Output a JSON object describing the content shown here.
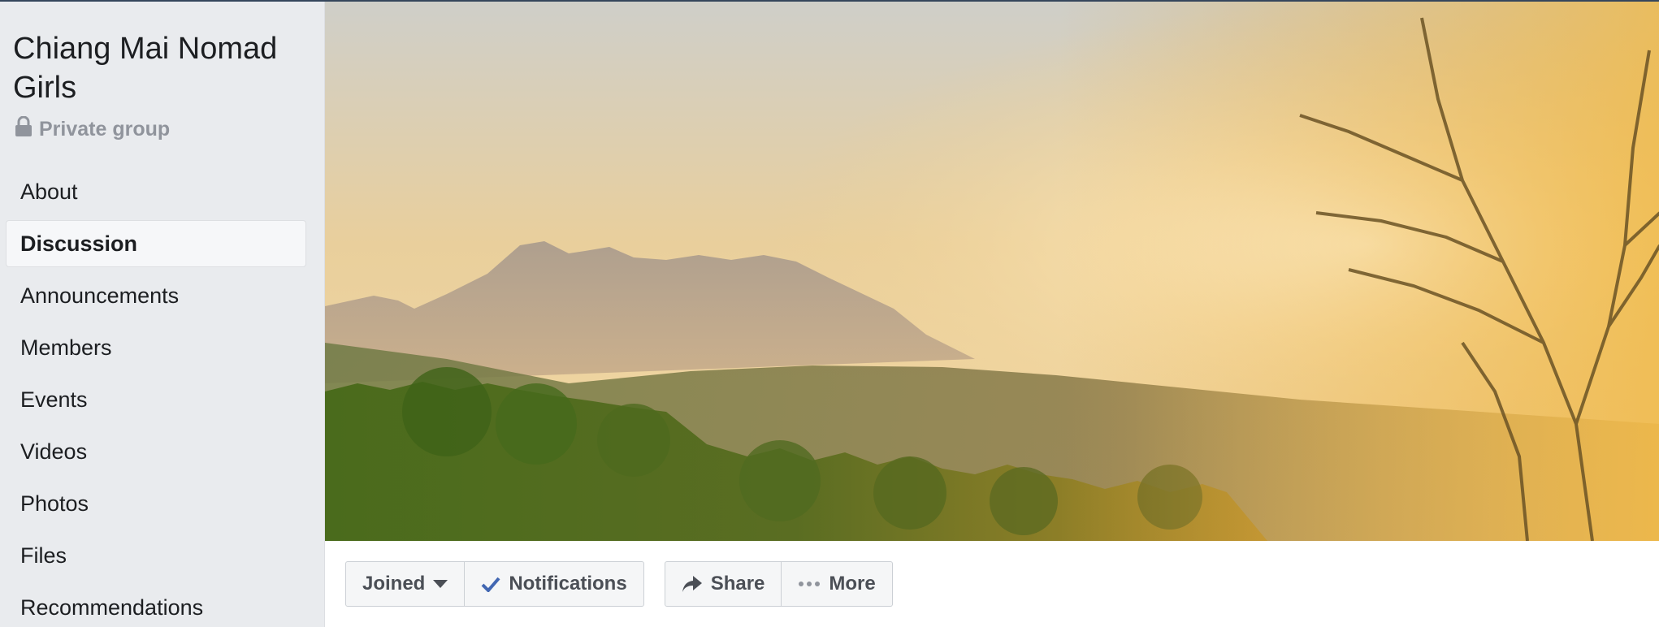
{
  "group": {
    "name": "Chiang Mai Nomad Girls",
    "privacy_label": "Private group",
    "privacy_icon": "lock-icon"
  },
  "sidebar": {
    "items": [
      {
        "label": "About",
        "active": false
      },
      {
        "label": "Discussion",
        "active": true
      },
      {
        "label": "Announcements",
        "active": false
      },
      {
        "label": "Members",
        "active": false
      },
      {
        "label": "Events",
        "active": false
      },
      {
        "label": "Videos",
        "active": false
      },
      {
        "label": "Photos",
        "active": false
      },
      {
        "label": "Files",
        "active": false
      },
      {
        "label": "Recommendations",
        "active": false
      }
    ]
  },
  "actions": {
    "joined_label": "Joined",
    "notifications_label": "Notifications",
    "share_label": "Share",
    "more_label": "More"
  },
  "colors": {
    "sidebar_bg": "#e9ebee",
    "accent_check": "#4267b2",
    "button_text": "#4b4f56"
  }
}
